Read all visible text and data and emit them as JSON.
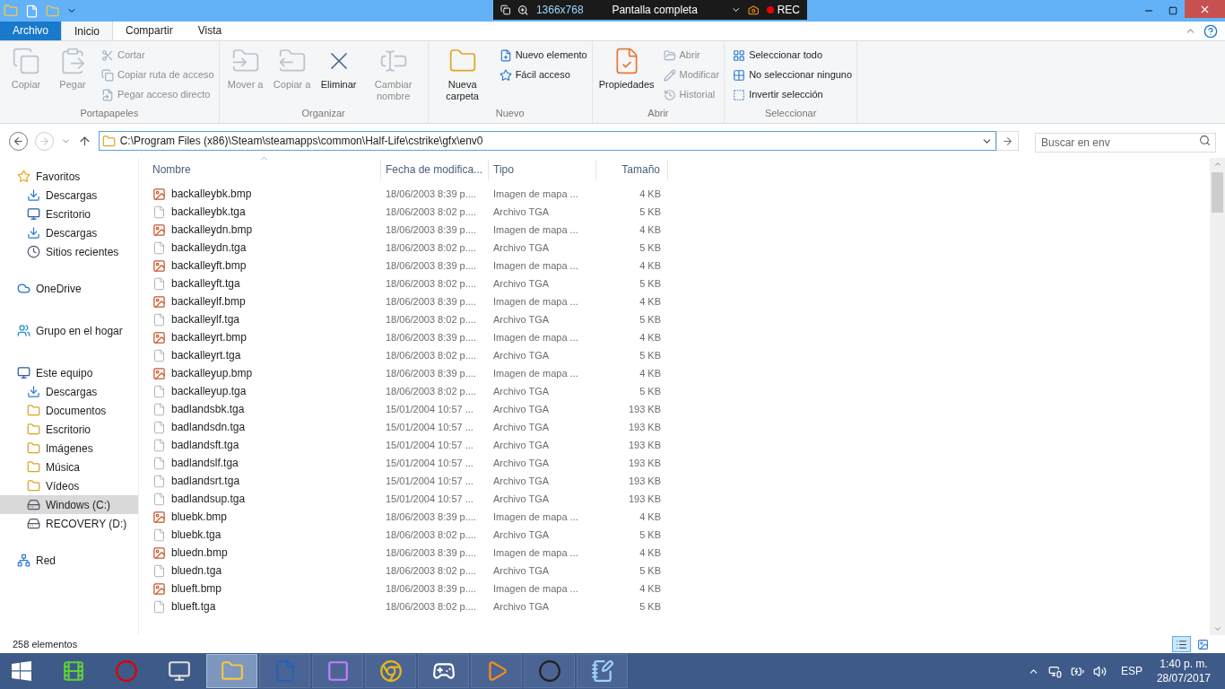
{
  "recorder": {
    "resolution": "1366x768",
    "mode": "Pantalla completa",
    "rec": "REC"
  },
  "ribbon_tabs": [
    {
      "label": "Archivo",
      "kind": "file",
      "selected": false
    },
    {
      "label": "Inicio",
      "kind": "tab",
      "selected": true
    },
    {
      "label": "Compartir",
      "kind": "tab",
      "selected": false
    },
    {
      "label": "Vista",
      "kind": "tab",
      "selected": false
    }
  ],
  "ribbon_groups": [
    {
      "title": "Portapapeles",
      "items": [
        {
          "label": "Copiar",
          "kind": "large",
          "disabled": true
        },
        {
          "label": "Pegar",
          "kind": "large",
          "disabled": true
        },
        {
          "label": "Cortar",
          "kind": "small",
          "disabled": true
        },
        {
          "label": "Copiar ruta de acceso",
          "kind": "small",
          "disabled": true
        },
        {
          "label": "Pegar acceso directo",
          "kind": "small",
          "disabled": true
        }
      ]
    },
    {
      "title": "Organizar",
      "items": [
        {
          "label": "Mover a",
          "kind": "large",
          "disabled": true
        },
        {
          "label": "Copiar a",
          "kind": "large",
          "disabled": true
        },
        {
          "label": "Eliminar",
          "kind": "large",
          "disabled": false
        },
        {
          "label": "Cambiar nombre",
          "kind": "large",
          "disabled": true
        }
      ]
    },
    {
      "title": "Nuevo",
      "items": [
        {
          "label": "Nueva carpeta",
          "kind": "large",
          "disabled": false
        },
        {
          "label": "Nuevo elemento",
          "kind": "small",
          "disabled": false
        },
        {
          "label": "Fácil acceso",
          "kind": "small",
          "disabled": false
        }
      ]
    },
    {
      "title": "Abrir",
      "items": [
        {
          "label": "Propiedades",
          "kind": "large",
          "disabled": false
        },
        {
          "label": "Abrir",
          "kind": "small",
          "disabled": true
        },
        {
          "label": "Modificar",
          "kind": "small",
          "disabled": true
        },
        {
          "label": "Historial",
          "kind": "small",
          "disabled": true
        }
      ]
    },
    {
      "title": "Seleccionar",
      "items": [
        {
          "label": "Seleccionar todo",
          "kind": "small",
          "disabled": false
        },
        {
          "label": "No seleccionar ninguno",
          "kind": "small",
          "disabled": false
        },
        {
          "label": "Invertir selección",
          "kind": "small",
          "disabled": false
        }
      ]
    }
  ],
  "address": {
    "path": "C:\\Program Files (x86)\\Steam\\steamapps\\common\\Half-Life\\cstrike\\gfx\\env0",
    "search_placeholder": "Buscar en env",
    "back_disabled": false,
    "forward_disabled": true
  },
  "sidebar": [
    {
      "label": "Favoritos",
      "kind": "star",
      "selected": false,
      "children": [
        {
          "label": "Descargas",
          "kind": "download",
          "selected": false
        },
        {
          "label": "Escritorio",
          "kind": "desktop",
          "selected": false
        },
        {
          "label": "Descargas",
          "kind": "download",
          "selected": false
        },
        {
          "label": "Sitios recientes",
          "kind": "recent",
          "selected": false
        }
      ]
    },
    {
      "label": "OneDrive",
      "kind": "cloud",
      "selected": false
    },
    {
      "label": "Grupo en el hogar",
      "kind": "home",
      "selected": false
    },
    {
      "label": "Este equipo",
      "kind": "pc",
      "selected": false,
      "children": [
        {
          "label": "Descargas",
          "kind": "download",
          "selected": false
        },
        {
          "label": "Documentos",
          "kind": "folder",
          "selected": false
        },
        {
          "label": "Escritorio",
          "kind": "folder",
          "selected": false
        },
        {
          "label": "Imágenes",
          "kind": "folder",
          "selected": false
        },
        {
          "label": "Música",
          "kind": "folder",
          "selected": false
        },
        {
          "label": "Vídeos",
          "kind": "folder",
          "selected": false
        },
        {
          "label": "Windows (C:)",
          "kind": "drive",
          "selected": true
        },
        {
          "label": "RECOVERY (D:)",
          "kind": "drive",
          "selected": false
        }
      ]
    },
    {
      "label": "Red",
      "kind": "network",
      "selected": false
    }
  ],
  "columns": [
    "Nombre",
    "Fecha de modifica...",
    "Tipo",
    "Tamaño"
  ],
  "files": [
    {
      "name": "backalleybk.bmp",
      "kind": "bmp",
      "date": "18/06/2003 8:39 p....",
      "type": "Imagen de mapa ...",
      "size": "4 KB"
    },
    {
      "name": "backalleybk.tga",
      "kind": "tga",
      "date": "18/06/2003 8:02 p....",
      "type": "Archivo TGA",
      "size": "5 KB"
    },
    {
      "name": "backalleydn.bmp",
      "kind": "bmp",
      "date": "18/06/2003 8:39 p....",
      "type": "Imagen de mapa ...",
      "size": "4 KB"
    },
    {
      "name": "backalleydn.tga",
      "kind": "tga",
      "date": "18/06/2003 8:02 p....",
      "type": "Archivo TGA",
      "size": "5 KB"
    },
    {
      "name": "backalleyft.bmp",
      "kind": "bmp",
      "date": "18/06/2003 8:39 p....",
      "type": "Imagen de mapa ...",
      "size": "4 KB"
    },
    {
      "name": "backalleyft.tga",
      "kind": "tga",
      "date": "18/06/2003 8:02 p....",
      "type": "Archivo TGA",
      "size": "5 KB"
    },
    {
      "name": "backalleylf.bmp",
      "kind": "bmp",
      "date": "18/06/2003 8:39 p....",
      "type": "Imagen de mapa ...",
      "size": "4 KB"
    },
    {
      "name": "backalleylf.tga",
      "kind": "tga",
      "date": "18/06/2003 8:02 p....",
      "type": "Archivo TGA",
      "size": "5 KB"
    },
    {
      "name": "backalleyrt.bmp",
      "kind": "bmp",
      "date": "18/06/2003 8:39 p....",
      "type": "Imagen de mapa ...",
      "size": "4 KB"
    },
    {
      "name": "backalleyrt.tga",
      "kind": "tga",
      "date": "18/06/2003 8:02 p....",
      "type": "Archivo TGA",
      "size": "5 KB"
    },
    {
      "name": "backalleyup.bmp",
      "kind": "bmp",
      "date": "18/06/2003 8:39 p....",
      "type": "Imagen de mapa ...",
      "size": "4 KB"
    },
    {
      "name": "backalleyup.tga",
      "kind": "tga",
      "date": "18/06/2003 8:02 p....",
      "type": "Archivo TGA",
      "size": "5 KB"
    },
    {
      "name": "badlandsbk.tga",
      "kind": "tga",
      "date": "15/01/2004 10:57 ...",
      "type": "Archivo TGA",
      "size": "193 KB"
    },
    {
      "name": "badlandsdn.tga",
      "kind": "tga",
      "date": "15/01/2004 10:57 ...",
      "type": "Archivo TGA",
      "size": "193 KB"
    },
    {
      "name": "badlandsft.tga",
      "kind": "tga",
      "date": "15/01/2004 10:57 ...",
      "type": "Archivo TGA",
      "size": "193 KB"
    },
    {
      "name": "badlandslf.tga",
      "kind": "tga",
      "date": "15/01/2004 10:57 ...",
      "type": "Archivo TGA",
      "size": "193 KB"
    },
    {
      "name": "badlandsrt.tga",
      "kind": "tga",
      "date": "15/01/2004 10:57 ...",
      "type": "Archivo TGA",
      "size": "193 KB"
    },
    {
      "name": "badlandsup.tga",
      "kind": "tga",
      "date": "15/01/2004 10:57 ...",
      "type": "Archivo TGA",
      "size": "193 KB"
    },
    {
      "name": "bluebk.bmp",
      "kind": "bmp",
      "date": "18/06/2003 8:39 p....",
      "type": "Imagen de mapa ...",
      "size": "4 KB"
    },
    {
      "name": "bluebk.tga",
      "kind": "tga",
      "date": "18/06/2003 8:02 p....",
      "type": "Archivo TGA",
      "size": "5 KB"
    },
    {
      "name": "bluedn.bmp",
      "kind": "bmp",
      "date": "18/06/2003 8:39 p....",
      "type": "Imagen de mapa ...",
      "size": "4 KB"
    },
    {
      "name": "bluedn.tga",
      "kind": "tga",
      "date": "18/06/2003 8:02 p....",
      "type": "Archivo TGA",
      "size": "5 KB"
    },
    {
      "name": "blueft.bmp",
      "kind": "bmp",
      "date": "18/06/2003 8:39 p....",
      "type": "Imagen de mapa ...",
      "size": "4 KB"
    },
    {
      "name": "blueft.tga",
      "kind": "tga",
      "date": "18/06/2003 8:02 p....",
      "type": "Archivo TGA",
      "size": "5 KB"
    }
  ],
  "status_bar": {
    "count": "258 elementos",
    "views": [
      {
        "kind": "details",
        "selected": true
      },
      {
        "kind": "large",
        "selected": false
      }
    ]
  },
  "taskbar": {
    "apps": [
      {
        "kind": "screen-recorder",
        "selected": false
      },
      {
        "kind": "record",
        "selected": false
      },
      {
        "kind": "monitor",
        "selected": false
      },
      {
        "kind": "explorer",
        "selected": true
      },
      {
        "kind": "word",
        "selected": false
      },
      {
        "kind": "premiere",
        "selected": false
      },
      {
        "kind": "browser",
        "selected": false
      },
      {
        "kind": "steam",
        "selected": false
      },
      {
        "kind": "player",
        "selected": false
      },
      {
        "kind": "obs",
        "selected": false
      },
      {
        "kind": "notepad",
        "selected": false
      }
    ],
    "language": "ESP",
    "time": "1:40 p. m.",
    "date": "28/07/2017"
  }
}
